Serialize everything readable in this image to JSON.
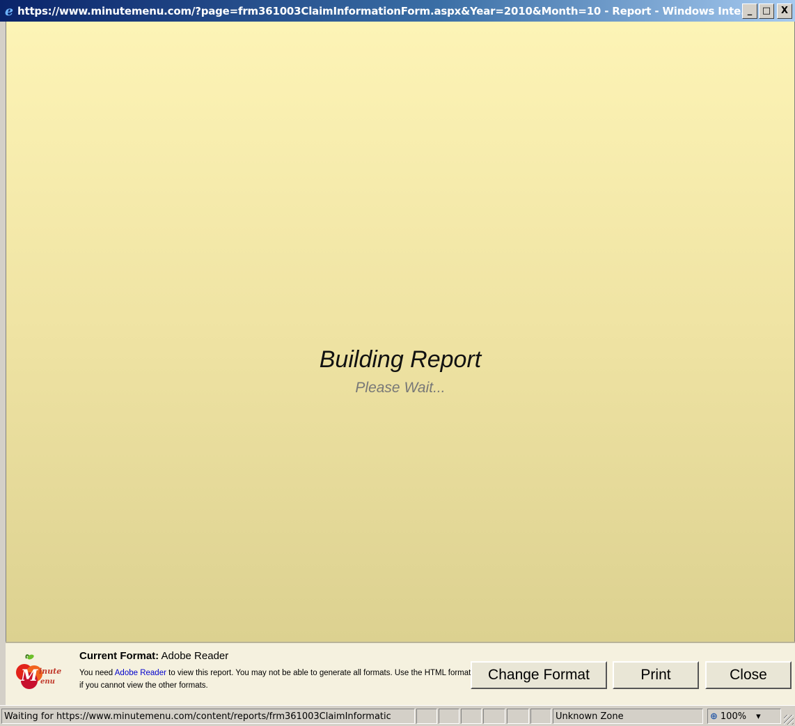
{
  "window": {
    "title": "https://www.minutemenu.com/?page=frm361003ClaimInformationForm.aspx&Year=2010&Month=10 - Report - Windows Inte...",
    "controls": {
      "minimize": "_",
      "maximize": "□",
      "close": "X"
    }
  },
  "loading": {
    "title": "Building Report",
    "subtitle": "Please Wait..."
  },
  "toolbar": {
    "logo_text_top": "inute",
    "logo_text_bottom": "enu",
    "format_label": "Current Format:",
    "format_value": "Adobe Reader",
    "note_pre": "You need",
    "note_link": "Adobe Reader",
    "note_post": "to view this report.  You may not be able to generate all formats. Use the HTML format if you cannot view the other formats.",
    "change_format_label": "Change Format",
    "print_label": "Print",
    "close_label": "Close"
  },
  "statusbar": {
    "message": "Waiting for https://www.minutemenu.com/content/reports/frm361003ClaimInformatic",
    "zone": "Unknown Zone",
    "zoom": "100%",
    "zoom_arrow": "▾"
  },
  "colors": {
    "title_bar": "#0a246a",
    "content_top": "#fdf4b6",
    "content_bottom": "#dcd190",
    "link": "#0000cc"
  }
}
